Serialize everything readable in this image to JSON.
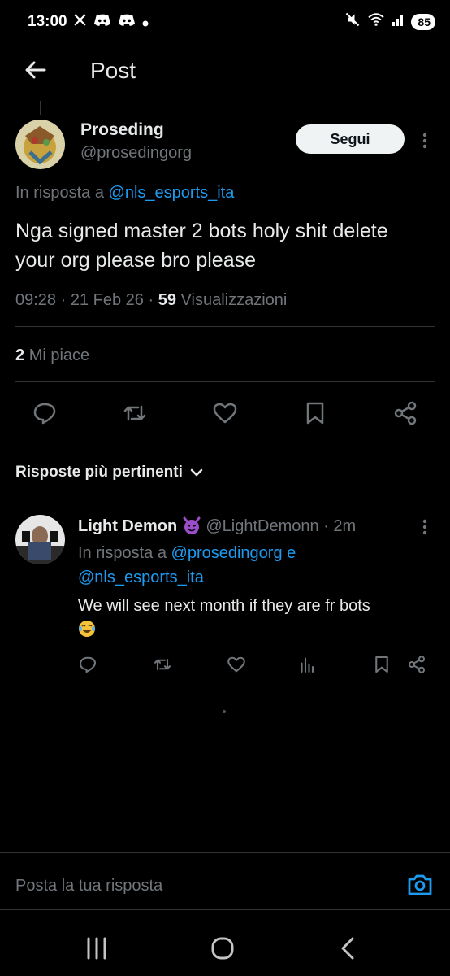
{
  "status_bar": {
    "time": "13:00",
    "left_icons": [
      "x-logo-icon",
      "discord-icon",
      "discord-icon",
      "dot-icon"
    ],
    "right_icons": [
      "mute-icon",
      "wifi-icon",
      "signal-icon"
    ],
    "battery": "85"
  },
  "header": {
    "title": "Post",
    "back_icon": "arrow-left-icon"
  },
  "post": {
    "author_name": "Proseding",
    "author_handle": "@prosedingorg",
    "follow_label": "Segui",
    "reply_prefix": "In risposta a",
    "reply_to": "@nls_esports_ita",
    "text": "Nga signed master 2 bots holy shit delete your org please bro please",
    "time": "09:28",
    "date": "21 Feb 26",
    "views_count": "59",
    "views_label": "Visualizzazioni",
    "likes_count": "2",
    "likes_label": "Mi piace"
  },
  "actions": [
    "reply-icon",
    "repost-icon",
    "like-icon",
    "bookmark-icon",
    "share-icon"
  ],
  "replies_sort": {
    "label": "Risposte più pertinenti"
  },
  "reply": {
    "author_name": "Light Demon",
    "author_handle": "@LightDemonn",
    "time": "2m",
    "reply_prefix": "In risposta a",
    "reply_to_1": "@prosedingorg",
    "conjunction": "e",
    "reply_to_2": "@nls_esports_ita",
    "text": "We will see next month if they are fr bots"
  },
  "compose": {
    "placeholder": "Posta la tua risposta"
  },
  "colors": {
    "background": "#000000",
    "text": "#e7e9ea",
    "muted": "#71767b",
    "link": "#1d9bf0",
    "divider": "#2f3336"
  }
}
